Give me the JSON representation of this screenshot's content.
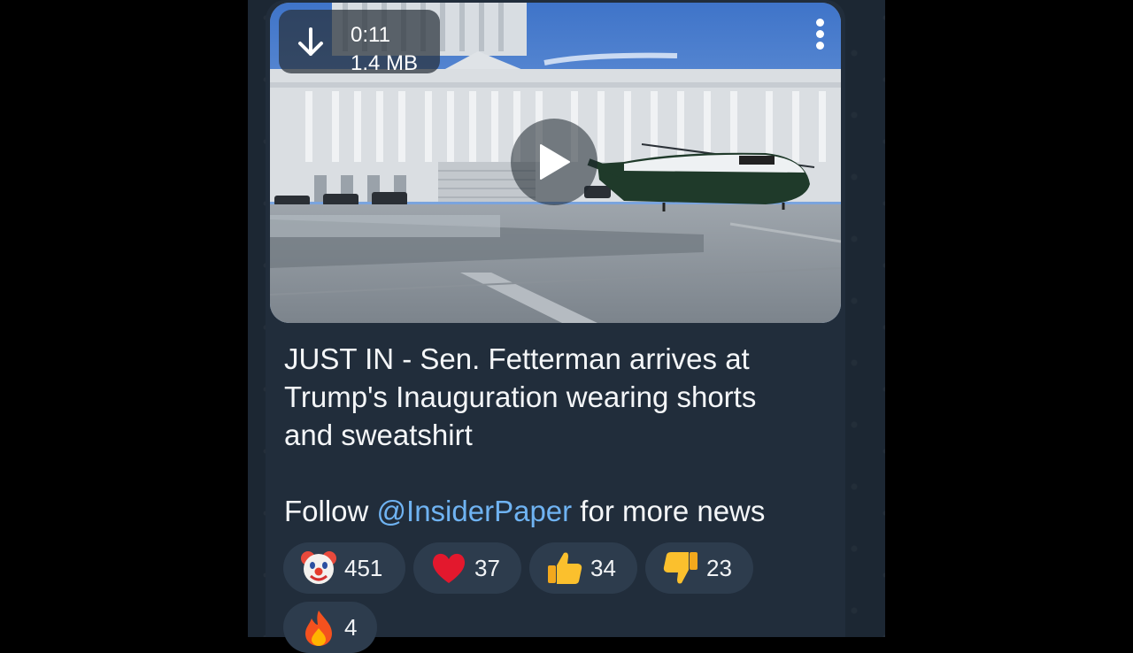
{
  "video": {
    "duration": "0:11",
    "size": "1.4 MB",
    "icons": {
      "download": "download-arrow-icon",
      "more": "more-vert-icon",
      "play": "play-icon"
    }
  },
  "post": {
    "line1": "JUST IN - Sen. Fetterman arrives at",
    "line2": "Trump's Inauguration wearing shorts",
    "line3": "and sweatshirt",
    "follow_prefix": "Follow ",
    "mention": "@InsiderPaper",
    "follow_suffix": " for more news"
  },
  "reactions": [
    {
      "emoji": "clown-face-icon",
      "count": "451"
    },
    {
      "emoji": "red-heart-icon",
      "count": "37"
    },
    {
      "emoji": "thumbs-up-icon",
      "count": "34"
    },
    {
      "emoji": "thumbs-down-icon",
      "count": "23"
    },
    {
      "emoji": "fire-icon",
      "count": "4"
    }
  ],
  "colors": {
    "mention": "#6fb3f2",
    "bubble": "#212d3b",
    "reaction_pill": "#2d3c4d"
  }
}
